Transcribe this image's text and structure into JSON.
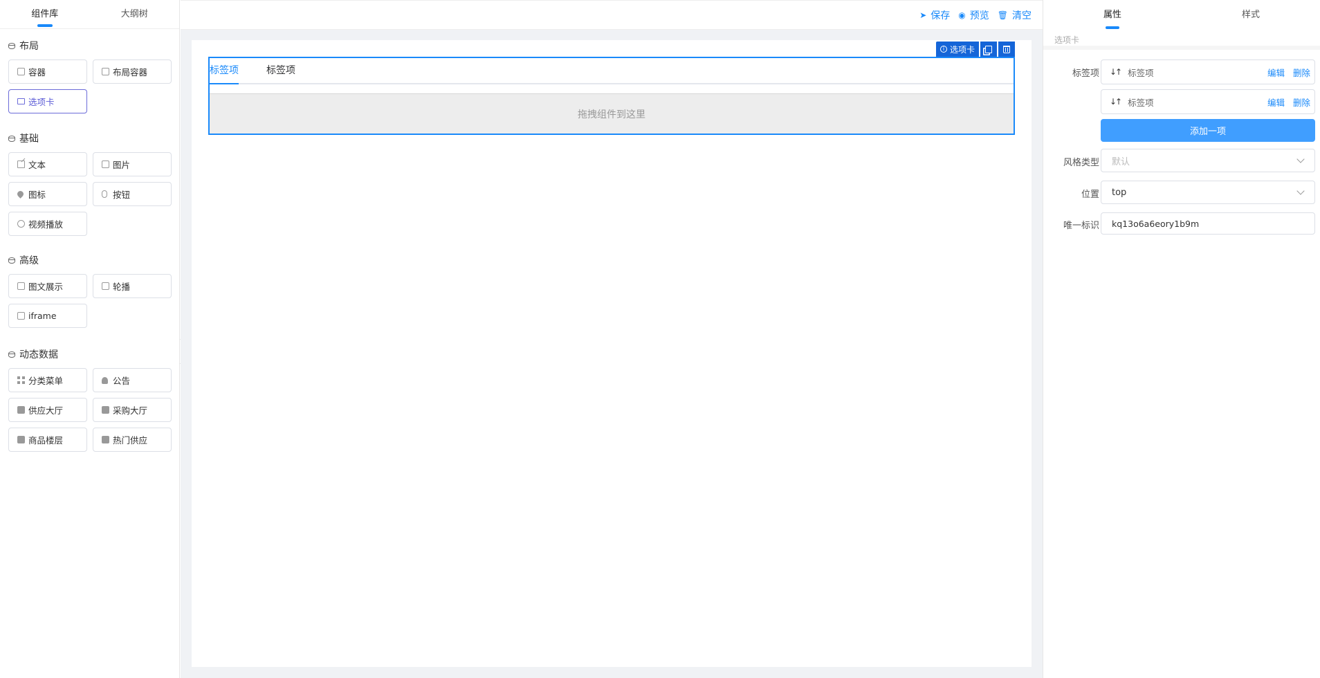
{
  "left": {
    "tabs": [
      {
        "label": "组件库"
      },
      {
        "label": "大纲树"
      }
    ],
    "groups": [
      {
        "title": "布局",
        "items": [
          {
            "label": "容器",
            "icon": "container-icon"
          },
          {
            "label": "布局容器",
            "icon": "layout-container-icon"
          },
          {
            "label": "选项卡",
            "icon": "folder-icon"
          }
        ]
      },
      {
        "title": "基础",
        "items": [
          {
            "label": "文本",
            "icon": "edit-icon"
          },
          {
            "label": "图片",
            "icon": "image-icon"
          },
          {
            "label": "图标",
            "icon": "location-icon"
          },
          {
            "label": "按钮",
            "icon": "mouse-icon"
          },
          {
            "label": "视频播放",
            "icon": "play-icon"
          }
        ]
      },
      {
        "title": "高级",
        "items": [
          {
            "label": "图文展示",
            "icon": "picture-text-icon"
          },
          {
            "label": "轮播",
            "icon": "carousel-icon"
          },
          {
            "label": "iframe",
            "icon": "iframe-icon"
          }
        ]
      },
      {
        "title": "动态数据",
        "items": [
          {
            "label": "分类菜单",
            "icon": "grid-icon"
          },
          {
            "label": "公告",
            "icon": "bell-icon"
          },
          {
            "label": "供应大厅",
            "icon": "clipboard-icon"
          },
          {
            "label": "采购大厅",
            "icon": "shop-icon"
          },
          {
            "label": "商品楼层",
            "icon": "basket-icon"
          },
          {
            "label": "热门供应",
            "icon": "printer-icon"
          }
        ]
      }
    ]
  },
  "toolbar": {
    "save": "保存",
    "preview": "预览",
    "clear": "清空"
  },
  "canvas": {
    "selected_label": "选项卡",
    "tabs": [
      "标签项",
      "标签项"
    ],
    "dropzone": "拖拽组件到这里"
  },
  "right": {
    "tabs": [
      "属性",
      "样式"
    ],
    "sub_title": "选项卡",
    "labels": {
      "tab_items": "标签项",
      "style_type": "风格类型",
      "position": "位置",
      "uid": "唯一标识"
    },
    "tab_items": [
      {
        "name": "标签项",
        "edit": "编辑",
        "delete": "删除"
      },
      {
        "name": "标签项",
        "edit": "编辑",
        "delete": "删除"
      }
    ],
    "add_button": "添加一项",
    "style_type_placeholder": "默认",
    "position_value": "top",
    "uid_value": "kq13o6a6eory1b9m"
  }
}
